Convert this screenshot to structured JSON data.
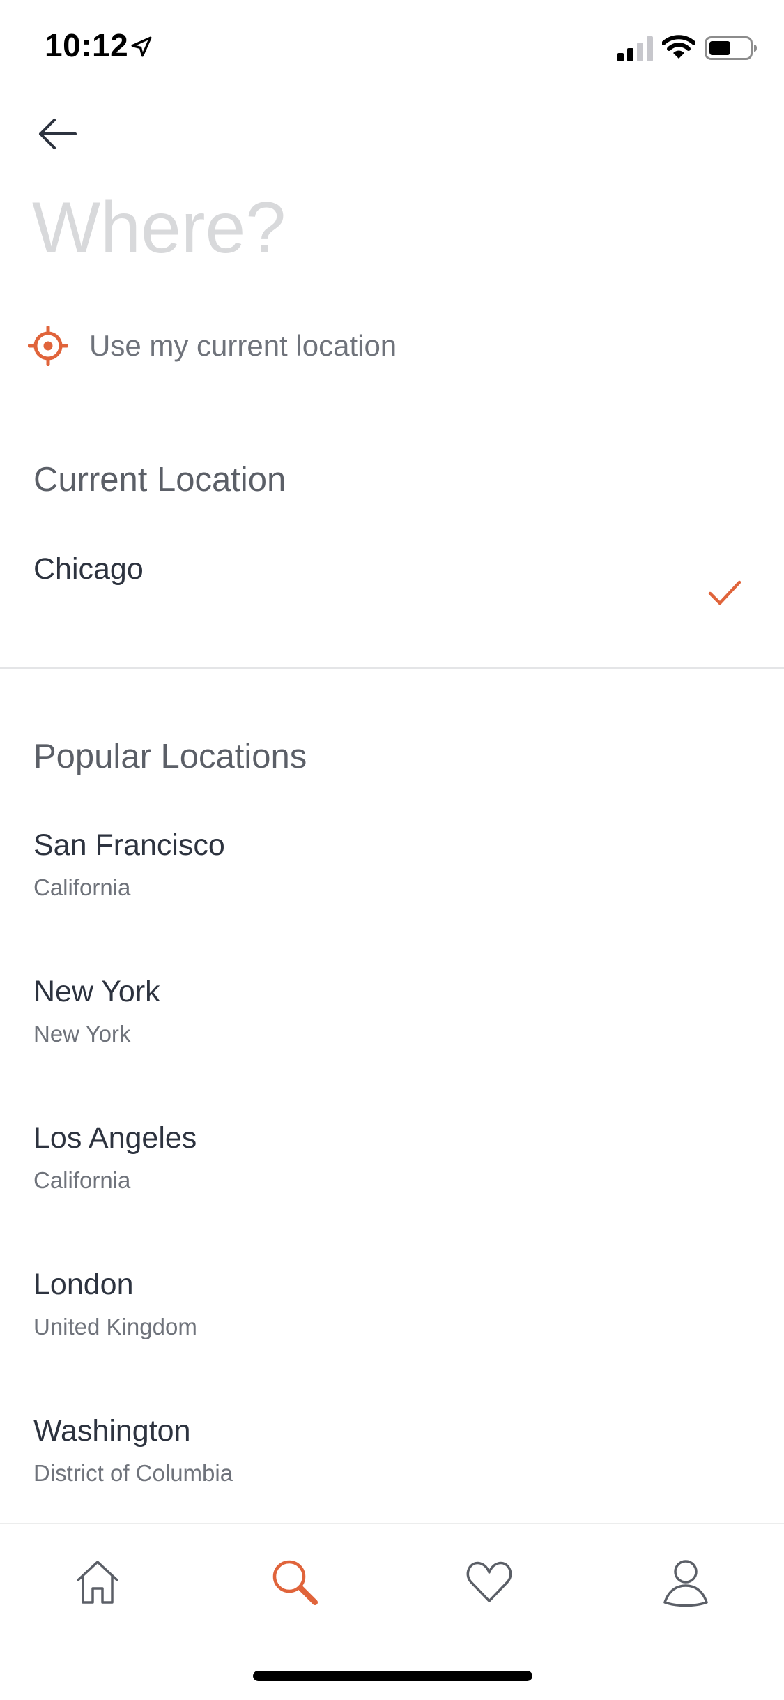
{
  "status_bar": {
    "time": "10:12"
  },
  "search": {
    "placeholder": "Where?",
    "value": ""
  },
  "use_current_location": {
    "label": "Use my current location",
    "icon": "crosshair-icon"
  },
  "current_location": {
    "heading": "Current Location",
    "city": "Chicago",
    "selected": true
  },
  "popular_locations": {
    "heading": "Popular Locations",
    "items": [
      {
        "city": "San Francisco",
        "region": "California"
      },
      {
        "city": "New York",
        "region": "New York"
      },
      {
        "city": "Los Angeles",
        "region": "California"
      },
      {
        "city": "London",
        "region": "United Kingdom"
      },
      {
        "city": "Washington",
        "region": "District of Columbia"
      }
    ]
  },
  "tab_bar": {
    "items": [
      {
        "name": "home",
        "icon": "home-icon",
        "active": false
      },
      {
        "name": "search",
        "icon": "search-icon",
        "active": true
      },
      {
        "name": "favorites",
        "icon": "heart-icon",
        "active": false
      },
      {
        "name": "profile",
        "icon": "profile-icon",
        "active": false
      }
    ]
  },
  "colors": {
    "accent": "#e0643b",
    "text_primary": "#2d333f",
    "text_secondary": "#6f737b",
    "placeholder": "#d8d9db",
    "divider": "#e4e5e7"
  }
}
